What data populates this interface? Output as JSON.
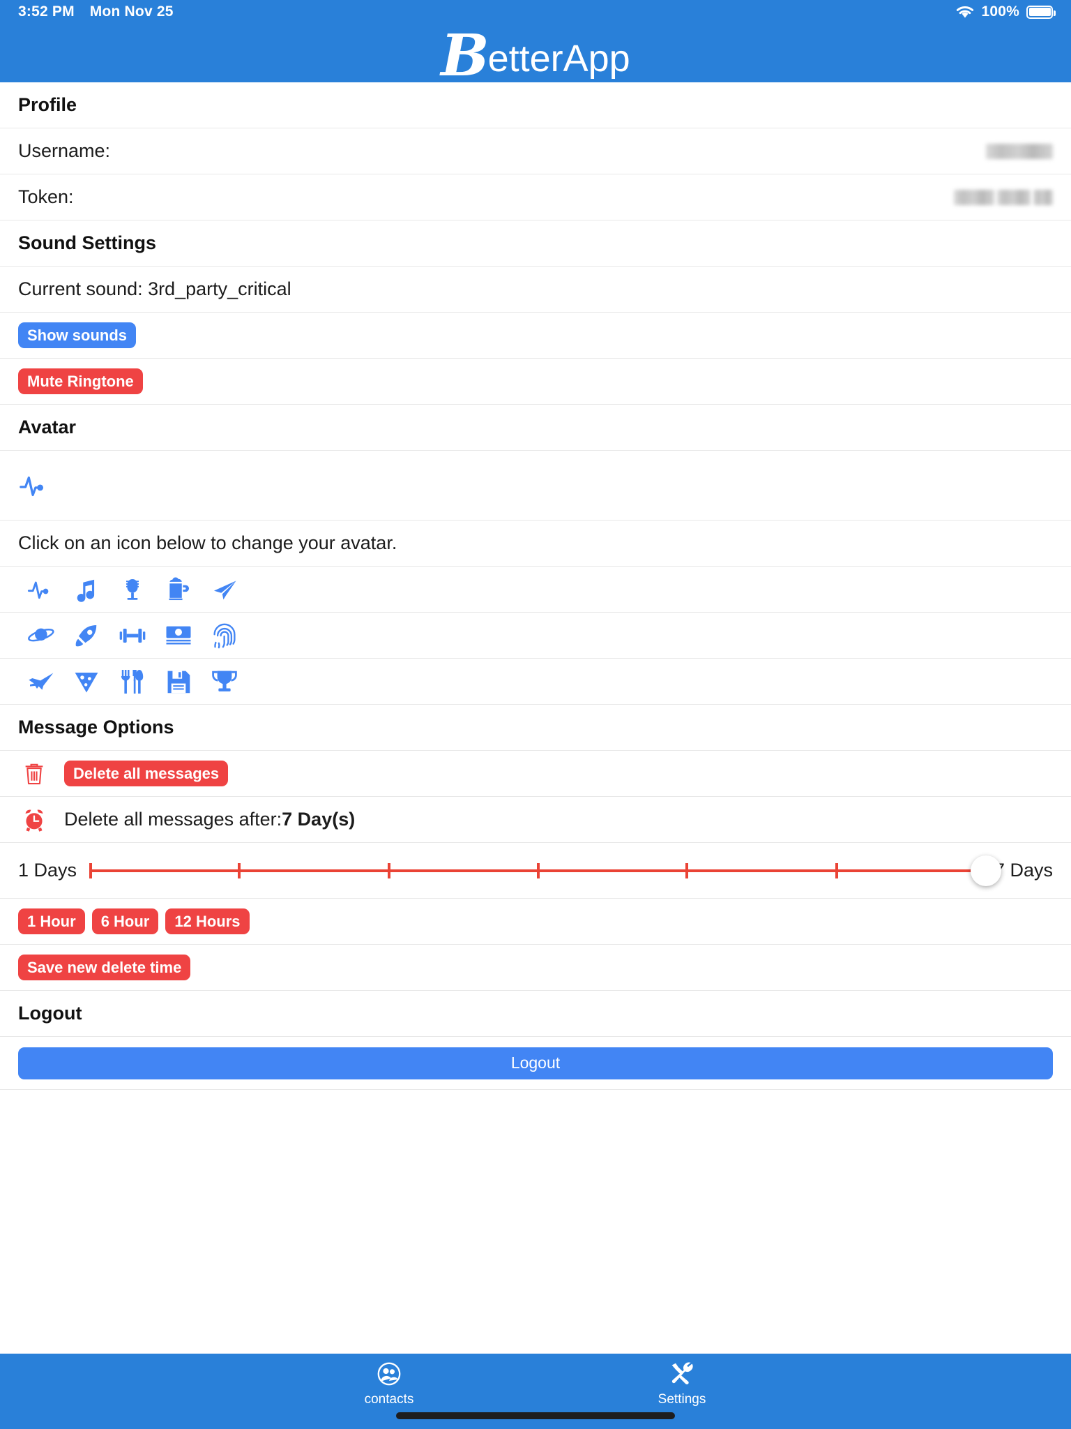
{
  "statusbar": {
    "time": "3:52 PM",
    "date": "Mon Nov 25",
    "battery_percent": "100%",
    "wifi_icon": "wifi-icon",
    "battery_icon": "battery-full-icon"
  },
  "header": {
    "logo_initial": "B",
    "logo_rest": "etterApp"
  },
  "sections": {
    "profile": {
      "title": "Profile",
      "username_label": "Username:",
      "username_value_redacted": true,
      "token_label": "Token:",
      "token_value_redacted": true
    },
    "sound": {
      "title": "Sound Settings",
      "current_sound_text": "Current sound: 3rd_party_critical",
      "show_sounds_label": "Show sounds",
      "mute_ringtone_label": "Mute Ringtone"
    },
    "avatar": {
      "title": "Avatar",
      "current_avatar_icon": "activity-pulse-icon",
      "instruction": "Click on an icon below to change your avatar.",
      "icons": [
        {
          "name": "activity-pulse-icon"
        },
        {
          "name": "music-note-icon"
        },
        {
          "name": "microphone-icon"
        },
        {
          "name": "beer-mug-icon"
        },
        {
          "name": "paper-plane-icon"
        },
        {
          "name": "planet-saturn-icon"
        },
        {
          "name": "rocket-icon"
        },
        {
          "name": "dumbbell-icon"
        },
        {
          "name": "money-bill-icon"
        },
        {
          "name": "fingerprint-icon"
        },
        {
          "name": "fighter-jet-icon"
        },
        {
          "name": "pizza-slice-icon"
        },
        {
          "name": "cutlery-icon"
        },
        {
          "name": "floppy-save-icon"
        },
        {
          "name": "trophy-icon"
        }
      ]
    },
    "message_options": {
      "title": "Message Options",
      "trash_icon": "trash-icon",
      "delete_all_label": "Delete all messages",
      "alarm_icon": "alarm-clock-icon",
      "delete_after_prefix": "Delete all messages after:",
      "delete_after_value": "7 Day(s)",
      "slider": {
        "min_label": "1 Days",
        "max_label": "7 Days",
        "min": 1,
        "max": 7,
        "value": 7,
        "tick_count": 5,
        "track_color": "#ea4335"
      },
      "quick_buttons": [
        {
          "label": "1 Hour"
        },
        {
          "label": "6 Hour"
        },
        {
          "label": "12 Hours"
        }
      ],
      "save_label": "Save new delete time"
    },
    "logout": {
      "title": "Logout",
      "button_label": "Logout"
    }
  },
  "tabbar": {
    "tabs": [
      {
        "label": "contacts",
        "icon": "contacts-people-icon"
      },
      {
        "label": "Settings",
        "icon": "tools-settings-icon"
      }
    ]
  },
  "colors": {
    "brand_blue": "#2980d9",
    "action_blue": "#4285f4",
    "danger_red": "#ef4343",
    "slider_red": "#ea4335"
  }
}
